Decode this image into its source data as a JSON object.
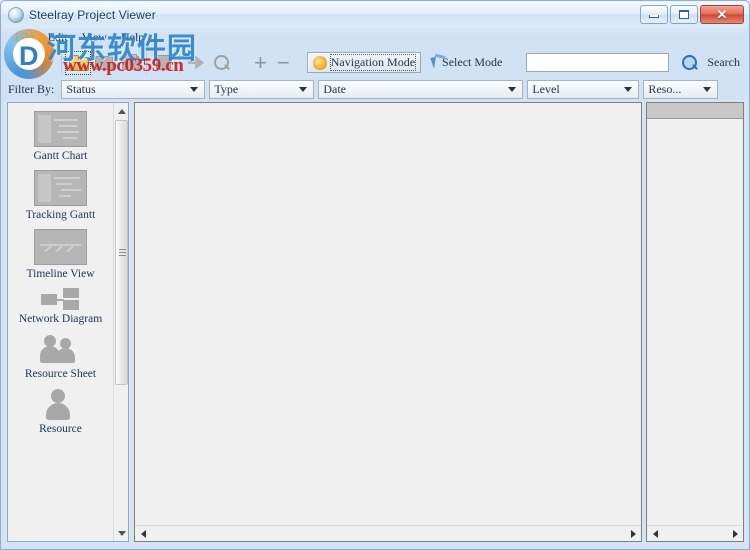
{
  "window": {
    "title": "Steelray Project Viewer",
    "icon": "app-globe-icon",
    "minimize_label": "",
    "maximize_label": "",
    "close_label": "✕"
  },
  "menu": {
    "items": [
      {
        "label": "File"
      },
      {
        "label": "Edit"
      },
      {
        "label": "View"
      },
      {
        "label": "Help"
      }
    ]
  },
  "toolbar": {
    "back_icon": "arrow-back-icon",
    "forward_icon": "arrow-forward-icon",
    "open_icon": "open-folder-icon",
    "print_icon": "print-icon",
    "export_icon": "export-icon",
    "copy_icon": "copy-icon",
    "zoom_out_icon": "zoom-out-icon",
    "find_icon": "find-icon",
    "expand_label": "+",
    "collapse_label": "−",
    "navigation_mode_label": "Navigation Mode",
    "navigation_mode_icon": "hand-icon",
    "select_mode_label": "Select Mode",
    "select_mode_icon": "arrow-cursor-icon",
    "search_value": "",
    "search_placeholder": "",
    "search_label": "Search",
    "search_icon": "search-magnifier-icon"
  },
  "filterbar": {
    "label": "Filter By:",
    "combos": [
      {
        "name": "status",
        "value": "Status"
      },
      {
        "name": "type",
        "value": "Type"
      },
      {
        "name": "date",
        "value": "Date"
      },
      {
        "name": "level",
        "value": "Level"
      },
      {
        "name": "resource",
        "value": "Reso..."
      }
    ]
  },
  "sidebar": {
    "items": [
      {
        "label": "Gantt Chart",
        "icon": "gantt-chart-icon"
      },
      {
        "label": "Tracking Gantt",
        "icon": "tracking-gantt-icon"
      },
      {
        "label": "Timeline View",
        "icon": "timeline-view-icon"
      },
      {
        "label": "Network Diagram",
        "icon": "network-diagram-icon"
      },
      {
        "label": "Resource Sheet",
        "icon": "resource-sheet-icon"
      },
      {
        "label": "Resource",
        "icon": "resource-icon"
      }
    ]
  },
  "main": {
    "content": "",
    "right_panel_content": ""
  },
  "watermark": {
    "brand_cn": "河东软件园",
    "url": "www.pc0359.cn",
    "logo_letter": "D"
  },
  "colors": {
    "accent": "#2f7fc4",
    "close_red": "#cf4a33",
    "watermark_red": "#cf1c1c",
    "frame_blue": "#8ab0d6"
  }
}
